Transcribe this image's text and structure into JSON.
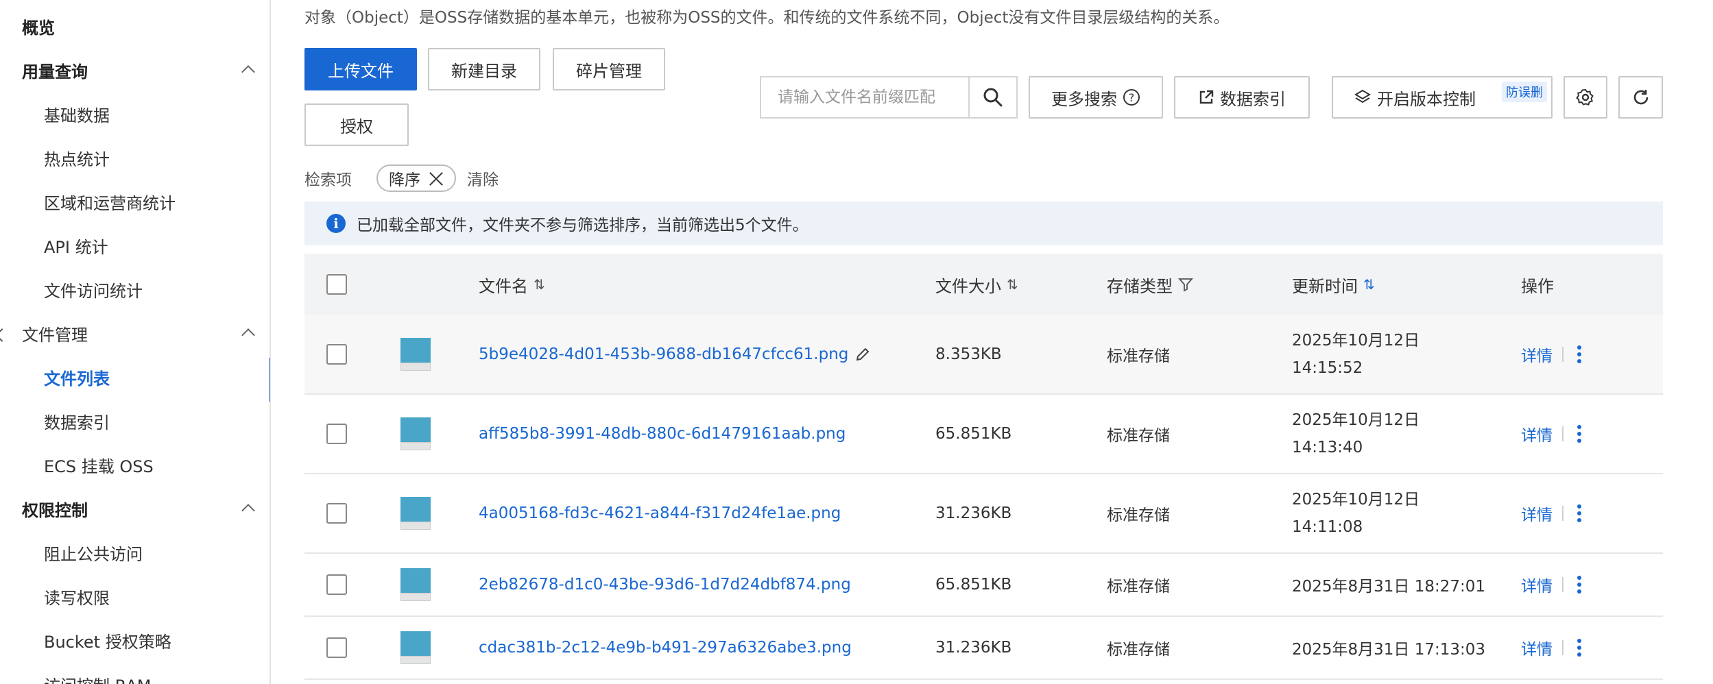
{
  "sidebar": {
    "items": [
      {
        "label": "概览",
        "kind": "top"
      },
      {
        "label": "用量查询",
        "kind": "group"
      },
      {
        "label": "基础数据",
        "kind": "sub"
      },
      {
        "label": "热点统计",
        "kind": "sub"
      },
      {
        "label": "区域和运营商统计",
        "kind": "sub"
      },
      {
        "label": "API 统计",
        "kind": "sub"
      },
      {
        "label": "文件访问统计",
        "kind": "sub"
      },
      {
        "label": "文件管理",
        "kind": "plain-group"
      },
      {
        "label": "文件列表",
        "kind": "sub-active"
      },
      {
        "label": "数据索引",
        "kind": "sub"
      },
      {
        "label": "ECS 挂载 OSS",
        "kind": "sub"
      },
      {
        "label": "权限控制",
        "kind": "group"
      },
      {
        "label": "阻止公共访问",
        "kind": "sub"
      },
      {
        "label": "读写权限",
        "kind": "sub"
      },
      {
        "label": "Bucket 授权策略",
        "kind": "sub"
      },
      {
        "label": "访问控制 RAM",
        "kind": "sub"
      }
    ]
  },
  "main": {
    "description": "对象（Object）是OSS存储数据的基本单元，也被称为OSS的文件。和传统的文件系统不同，Object没有文件目录层级结构的关系。",
    "toolbar": {
      "upload": "上传文件",
      "new_dir": "新建目录",
      "fragments": "碎片管理",
      "authorize": "授权",
      "search_placeholder": "请输入文件名前缀匹配",
      "more_search": "更多搜索",
      "data_index": "数据索引",
      "versioning": "开启版本控制",
      "versioning_badge": "防误删"
    },
    "filter": {
      "label": "检索项",
      "chip": "降序",
      "clear": "清除"
    },
    "info": "已加载全部文件，文件夹不参与筛选排序，当前筛选出5个文件。",
    "table": {
      "headers": {
        "name": "文件名",
        "size": "文件大小",
        "storage": "存储类型",
        "updated": "更新时间",
        "actions": "操作"
      },
      "rows": [
        {
          "name": "5b9e4028-4d01-453b-9688-db1647cfcc61.png",
          "size": "8.353KB",
          "storage": "标准存储",
          "date": "2025年10月12日",
          "time": "14:15:52",
          "detail": "详情"
        },
        {
          "name": "aff585b8-3991-48db-880c-6d1479161aab.png",
          "size": "65.851KB",
          "storage": "标准存储",
          "date": "2025年10月12日",
          "time": "14:13:40",
          "detail": "详情"
        },
        {
          "name": "4a005168-fd3c-4621-a844-f317d24fe1ae.png",
          "size": "31.236KB",
          "storage": "标准存储",
          "date": "2025年10月12日",
          "time": "14:11:08",
          "detail": "详情"
        },
        {
          "name": "2eb82678-d1c0-43be-93d6-1d7d24dbf874.png",
          "size": "65.851KB",
          "storage": "标准存储",
          "date": "2025年8月31日 18:27:01",
          "time": "",
          "detail": "详情"
        },
        {
          "name": "cdac381b-2c12-4e9b-b491-297a6326abe3.png",
          "size": "31.236KB",
          "storage": "标准存储",
          "date": "2025年8月31日 17:13:03",
          "time": "",
          "detail": "详情"
        }
      ]
    }
  },
  "colors": {
    "accent": "#1967d2",
    "info_bg": "#edf2f8",
    "header_bg": "#f2f3f5"
  }
}
